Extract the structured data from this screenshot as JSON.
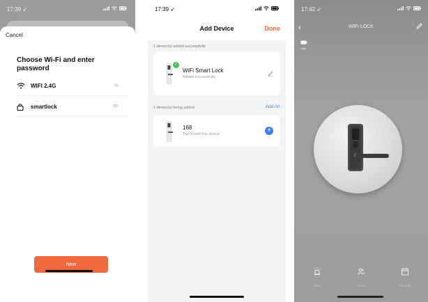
{
  "screen1": {
    "status_time": "17:39",
    "cancel_label": "Cancel",
    "heading": "Choose Wi-Fi and enter password",
    "wifi_name": "WIFI 2.4G",
    "wifi_trailing": "⇆",
    "password_value": "smartlock",
    "next_label": "Next"
  },
  "screen2": {
    "status_time": "17:39",
    "nav_title": "Add Device",
    "done_label": "Done",
    "section_added": "1 device(s) added successfully",
    "added_device": {
      "name": "WiFi Smart Lock",
      "status": "Added successfully"
    },
    "section_adding": "1 device(s) being added",
    "add_all_label": "Add All",
    "pending_device": {
      "name": "168",
      "status": "Tap to add this device"
    }
  },
  "screen3": {
    "status_time": "17:42",
    "title": "WIFI LOCK",
    "battery_label": "High",
    "tabs": [
      {
        "label": "Alarm",
        "icon": "alarm-icon"
      },
      {
        "label": "Users",
        "icon": "users-icon"
      },
      {
        "label": "Records",
        "icon": "calendar-icon"
      }
    ]
  },
  "colors": {
    "accent_orange": "#ee6a3e",
    "link_blue": "#3d7ff2",
    "success_green": "#48c15a",
    "lock_bg_gray": "#9d9d9d"
  }
}
